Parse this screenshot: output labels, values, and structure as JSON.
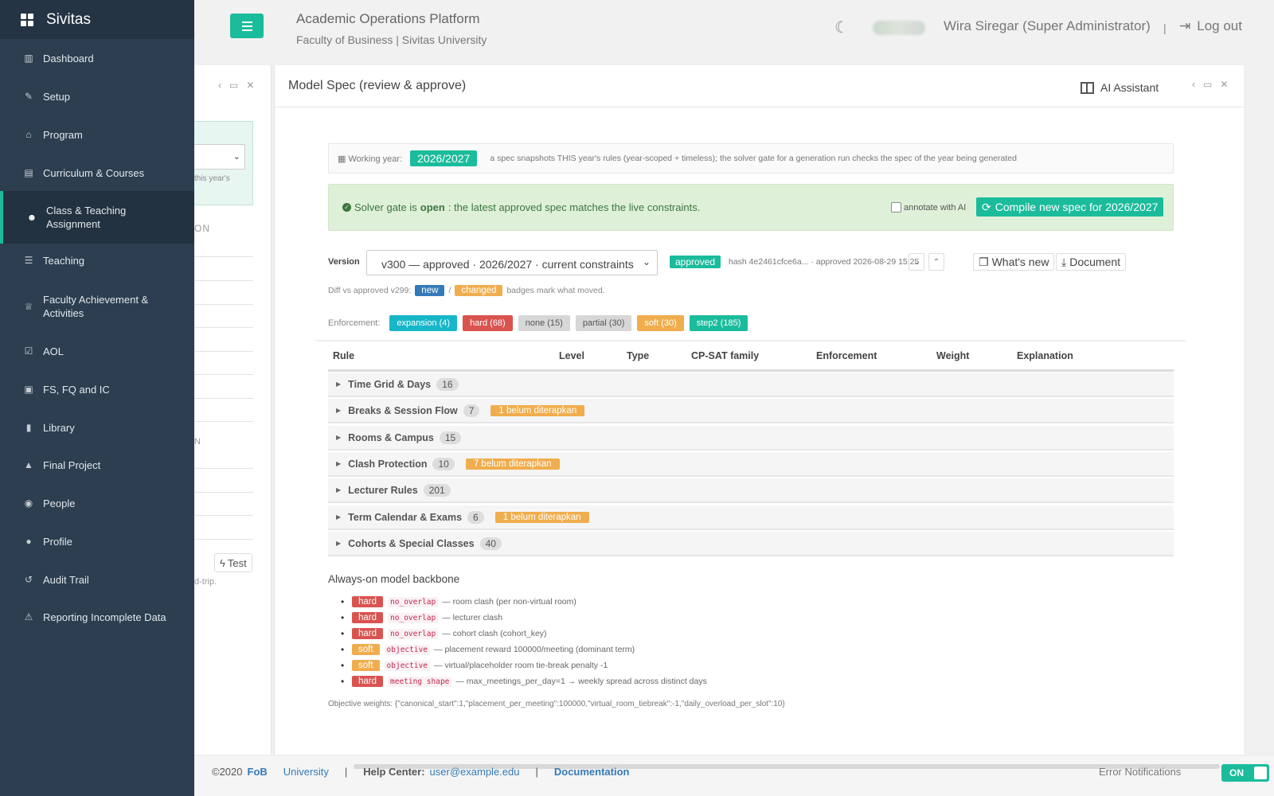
{
  "sidebar": {
    "brand": "Sivitas",
    "items": [
      {
        "label": "Dashboard",
        "icon": "bar-chart-icon",
        "glyph": "▥"
      },
      {
        "label": "Setup",
        "icon": "wrench-icon",
        "glyph": "✎"
      },
      {
        "label": "Program",
        "icon": "bank-icon",
        "glyph": "⌂"
      },
      {
        "label": "Curriculum & Courses",
        "icon": "file-icon",
        "glyph": "▤"
      },
      {
        "label": "Class & Teaching Assignment",
        "icon": "users-icon",
        "glyph": "☻"
      },
      {
        "label": "Teaching",
        "icon": "list-icon",
        "glyph": "☰"
      },
      {
        "label": "Faculty Achievement & Activities",
        "icon": "trophy-icon",
        "glyph": "♕"
      },
      {
        "label": "AOL",
        "icon": "check-square-icon",
        "glyph": "☑"
      },
      {
        "label": "FS, FQ and IC",
        "icon": "id-card-icon",
        "glyph": "▣"
      },
      {
        "label": "Library",
        "icon": "book-icon",
        "glyph": "▮"
      },
      {
        "label": "Final Project",
        "icon": "graduation-cap-icon",
        "glyph": "▲"
      },
      {
        "label": "People",
        "icon": "user-circle-icon",
        "glyph": "◉"
      },
      {
        "label": "Profile",
        "icon": "user-icon",
        "glyph": "●"
      },
      {
        "label": "Audit Trail",
        "icon": "history-icon",
        "glyph": "↺"
      },
      {
        "label": "Reporting Incomplete Data",
        "icon": "warning-icon",
        "glyph": "⚠"
      }
    ]
  },
  "header": {
    "title": "Academic Operations Platform",
    "subtitle": "Faculty of Business | Sivitas University",
    "user": "Wira Siregar (Super Administrator)",
    "separator": "|",
    "logout": "Log out"
  },
  "left_panel": {
    "hint": "this year's",
    "label": "ON",
    "letter": "N",
    "test_btn": "Test",
    "trip": "d-trip."
  },
  "main": {
    "title": "Model Spec (review & approve)",
    "ai_assistant": "AI Assistant",
    "working_year_label": "Working year:",
    "working_year": "2026/2027",
    "working_year_note": "a spec snapshots THIS year's rules (year-scoped + timeless); the solver gate for a generation run checks the spec of the year being generated",
    "gate_prefix": "Solver gate is ",
    "gate_status": "open",
    "gate_suffix": ": the latest approved spec matches the live constraints.",
    "annotate_label": "annotate with AI",
    "compile_btn": "Compile new spec for 2026/2027",
    "version_label": "Version",
    "version_value": "v300 — approved · 2026/2027 · current constraints",
    "approved_badge": "approved",
    "hash_text": "hash 4e2461cfce6a... · approved 2026-08-29 15:25",
    "whats_new": "What's new",
    "document": "Document",
    "diff_prefix": "Diff vs approved v299:",
    "diff_new": "new",
    "diff_slash": "/",
    "diff_changed": "changed",
    "diff_suffix": "badges mark what moved.",
    "enforcement_label": "Enforcement:",
    "enforcement": [
      {
        "label": "expansion (4)",
        "color": "#17b7c9"
      },
      {
        "label": "hard (68)",
        "color": "#d9534f"
      },
      {
        "label": "none (15)",
        "color": "#d7d7d7",
        "text": "#555"
      },
      {
        "label": "partial (30)",
        "color": "#d7d7d7",
        "text": "#555"
      },
      {
        "label": "soft (30)",
        "color": "#f0ad4e"
      },
      {
        "label": "step2 (185)",
        "color": "#1abc9c"
      }
    ],
    "columns": [
      "Rule",
      "Level",
      "Type",
      "CP-SAT family",
      "Enforcement",
      "Weight",
      "Explanation"
    ],
    "groups": [
      {
        "name": "Time Grid & Days",
        "count": "16",
        "warn": ""
      },
      {
        "name": "Breaks & Session Flow",
        "count": "7",
        "warn": "1 belum diterapkan"
      },
      {
        "name": "Rooms & Campus",
        "count": "15",
        "warn": ""
      },
      {
        "name": "Clash Protection",
        "count": "10",
        "warn": "7 belum diterapkan"
      },
      {
        "name": "Lecturer Rules",
        "count": "201",
        "warn": ""
      },
      {
        "name": "Term Calendar & Exams",
        "count": "6",
        "warn": "1 belum diterapkan"
      },
      {
        "name": "Cohorts & Special Classes",
        "count": "40",
        "warn": ""
      }
    ],
    "backbone_title": "Always-on model backbone",
    "backbone": [
      {
        "level": "hard",
        "code": "no_overlap",
        "text": "— room clash (per non-virtual room)"
      },
      {
        "level": "hard",
        "code": "no_overlap",
        "text": "— lecturer clash"
      },
      {
        "level": "hard",
        "code": "no_overlap",
        "text": "— cohort clash (cohort_key)"
      },
      {
        "level": "soft",
        "code": "objective",
        "text": "— placement reward 100000/meeting (dominant term)"
      },
      {
        "level": "soft",
        "code": "objective",
        "text": "— virtual/placeholder room tie-break penalty -1"
      },
      {
        "level": "hard",
        "code": "meeting shape",
        "text": "— max_meetings_per_day=1 → weekly spread across distinct days"
      }
    ],
    "objective_weights": "Objective weights: {\"canonical_start\":1,\"placement_per_meeting\":100000,\"virtual_room_tiebreak\":-1,\"daily_overload_per_slot\":10}"
  },
  "footer": {
    "copyright": "©2020",
    "fob": "FoB",
    "university": "University",
    "sep": "|",
    "help_label": "Help Center:",
    "help_email": "user@example.edu",
    "documentation": "Documentation",
    "error_notifications": "Error Notifications",
    "toggle": "ON"
  }
}
